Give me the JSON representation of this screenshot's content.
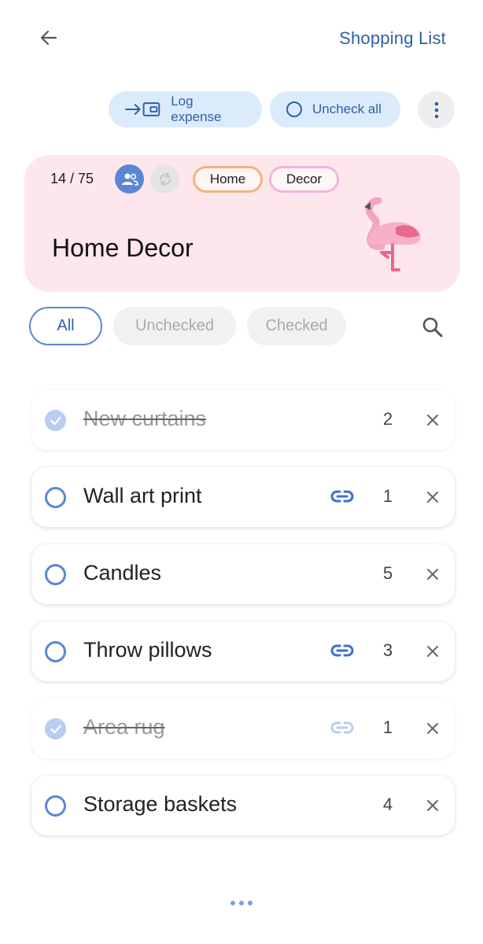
{
  "header": {
    "back_icon": "arrow-left-icon",
    "title": "Shopping List"
  },
  "actions": {
    "log_expense_label": "Log expense",
    "log_expense_icon": "wallet-arrow-icon",
    "uncheck_all_label": "Uncheck all",
    "uncheck_all_icon": "circle-outline-icon",
    "more_icon": "more-vertical-icon"
  },
  "list_card": {
    "count": "14 / 75",
    "shared_icon": "people-icon",
    "sync_icon": "sync-icon",
    "tags": [
      "Home",
      "Decor"
    ],
    "title": "Home Decor",
    "emoji_icon": "flamingo-icon",
    "background": "#fde6ec"
  },
  "filters": {
    "all": "All",
    "unchecked": "Unchecked",
    "checked": "Checked",
    "search_icon": "search-icon"
  },
  "items": [
    {
      "name": "New curtains",
      "qty": "2",
      "checked": true,
      "linked": false
    },
    {
      "name": "Wall art print",
      "qty": "1",
      "checked": false,
      "linked": true
    },
    {
      "name": "Candles",
      "qty": "5",
      "checked": false,
      "linked": false
    },
    {
      "name": "Throw pillows",
      "qty": "3",
      "checked": false,
      "linked": true
    },
    {
      "name": "Area rug",
      "qty": "1",
      "checked": true,
      "linked": true
    },
    {
      "name": "Storage baskets",
      "qty": "4",
      "checked": false,
      "linked": false
    }
  ],
  "colors": {
    "accent": "#2f5fa8",
    "accent_light": "#dcebfb",
    "check_blue": "#5b86d6"
  }
}
